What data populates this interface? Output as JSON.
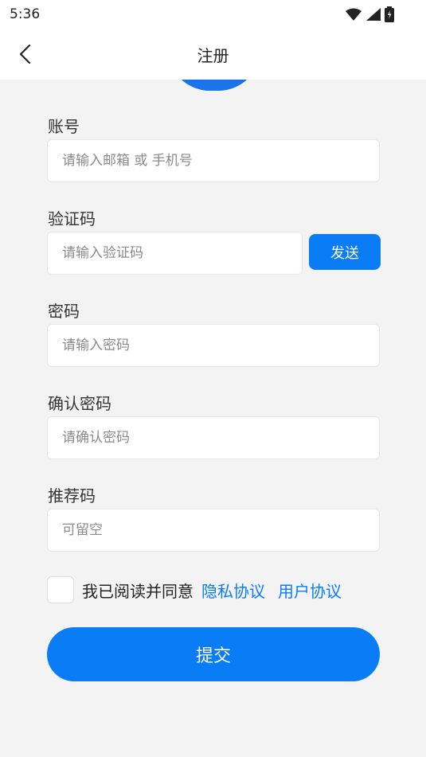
{
  "status_bar": {
    "time": "5:36",
    "icons": [
      "wifi-icon",
      "signal-icon",
      "battery-icon"
    ]
  },
  "nav": {
    "title": "注册",
    "back_icon": "chevron-left-icon"
  },
  "fields": {
    "account": {
      "label": "账号",
      "placeholder": "请输入邮箱 或 手机号"
    },
    "code": {
      "label": "验证码",
      "placeholder": "请输入验证码",
      "send_label": "发送"
    },
    "password": {
      "label": "密码",
      "placeholder": "请输入密码"
    },
    "confirm": {
      "label": "确认密码",
      "placeholder": "请确认密码"
    },
    "referral": {
      "label": "推荐码",
      "placeholder": "可留空"
    }
  },
  "agreement": {
    "text": "我已阅读并同意",
    "privacy_link": "隐私协议",
    "user_link": "用户协议"
  },
  "submit_label": "提交",
  "colors": {
    "accent": "#0a7cf5",
    "background": "#f3f3f3"
  }
}
